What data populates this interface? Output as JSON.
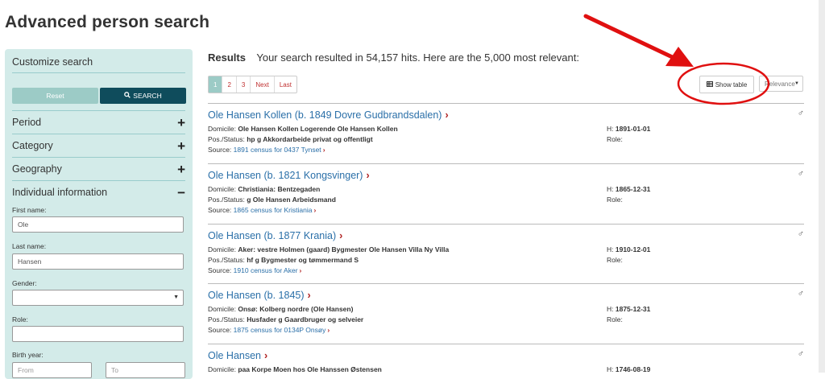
{
  "page_title": "Advanced person search",
  "sidebar": {
    "customize_title": "Customize search",
    "reset_label": "Reset",
    "search_label": "SEARCH",
    "sections": [
      {
        "label": "Period",
        "sign": "+"
      },
      {
        "label": "Category",
        "sign": "+"
      },
      {
        "label": "Geography",
        "sign": "+"
      },
      {
        "label": "Individual information",
        "sign": "−"
      }
    ],
    "fields": {
      "first_name_label": "First name:",
      "first_name_value": "Ole",
      "last_name_label": "Last name:",
      "last_name_value": "Hansen",
      "gender_label": "Gender:",
      "gender_value": "",
      "role_label": "Role:",
      "role_value": "",
      "birth_year_label": "Birth year:",
      "birth_from_placeholder": "From",
      "birth_to_placeholder": "To"
    }
  },
  "results": {
    "heading": "Results",
    "summary": "Your search resulted in 54,157 hits. Here are the 5,000 most relevant:",
    "pager": [
      "1",
      "2",
      "3",
      "Next",
      "Last"
    ],
    "show_table_label": "Show table",
    "sort_value": "Relevance",
    "records": [
      {
        "name": "Ole Hansen Kollen (b. 1849 Dovre Gudbrandsdalen)",
        "domicile_label": "Domicile:",
        "domicile": "Ole Hansen Kollen Logerende Ole Hansen Kollen",
        "pos_label": "Pos./Status:",
        "pos": "hp g Akkordarbeide privat og offentligt",
        "source_label": "Source:",
        "source": "1891 census for 0437 Tynset",
        "h_label": "H:",
        "h": "1891-01-01",
        "role_label": "Role:"
      },
      {
        "name": "Ole Hansen (b. 1821 Kongsvinger)",
        "domicile_label": "Domicile:",
        "domicile": "Christiania: Bentzegaden",
        "pos_label": "Pos./Status:",
        "pos": "g Ole Hansen Arbeidsmand",
        "source_label": "Source:",
        "source": "1865 census for Kristiania",
        "h_label": "H:",
        "h": "1865-12-31",
        "role_label": "Role:"
      },
      {
        "name": "Ole Hansen (b. 1877 Krania)",
        "domicile_label": "Domicile:",
        "domicile": "Aker: vestre Holmen (gaard) Bygmester Ole Hansen Villa Ny Villa",
        "pos_label": "Pos./Status:",
        "pos": "hf g Bygmester og tømmermand S",
        "source_label": "Source:",
        "source": "1910 census for Aker",
        "h_label": "H:",
        "h": "1910-12-01",
        "role_label": "Role:"
      },
      {
        "name": "Ole Hansen (b. 1845)",
        "domicile_label": "Domicile:",
        "domicile": "Onsø: Kolberg nordre (Ole Hansen)",
        "pos_label": "Pos./Status:",
        "pos": "Husfader g Gaardbruger og selveier",
        "source_label": "Source:",
        "source": "1875 census for 0134P Onsøy",
        "h_label": "H:",
        "h": "1875-12-31",
        "role_label": "Role:"
      },
      {
        "name": "Ole Hansen",
        "domicile_label": "Domicile:",
        "domicile": "paa Korpe Moen hos Ole Hanssen Østensen",
        "pos_label": "Pos./Status:",
        "pos": "",
        "source_label": "Source:",
        "source": "",
        "h_label": "H:",
        "h": "1746-08-19",
        "role_label": "Role:"
      }
    ],
    "gender_symbol": "♂"
  },
  "colors": {
    "sidebar_bg": "#d3ebe9",
    "search_button": "#0f4c5c",
    "reset_button": "#9ccbc6",
    "link": "#2a6fa8",
    "chevron": "#b02020",
    "annotation": "#e01010"
  },
  "icons": [
    "search-icon",
    "plus-icon",
    "minus-icon",
    "table-icon",
    "chevron-right-icon",
    "male-symbol-icon",
    "caret-down-icon"
  ]
}
